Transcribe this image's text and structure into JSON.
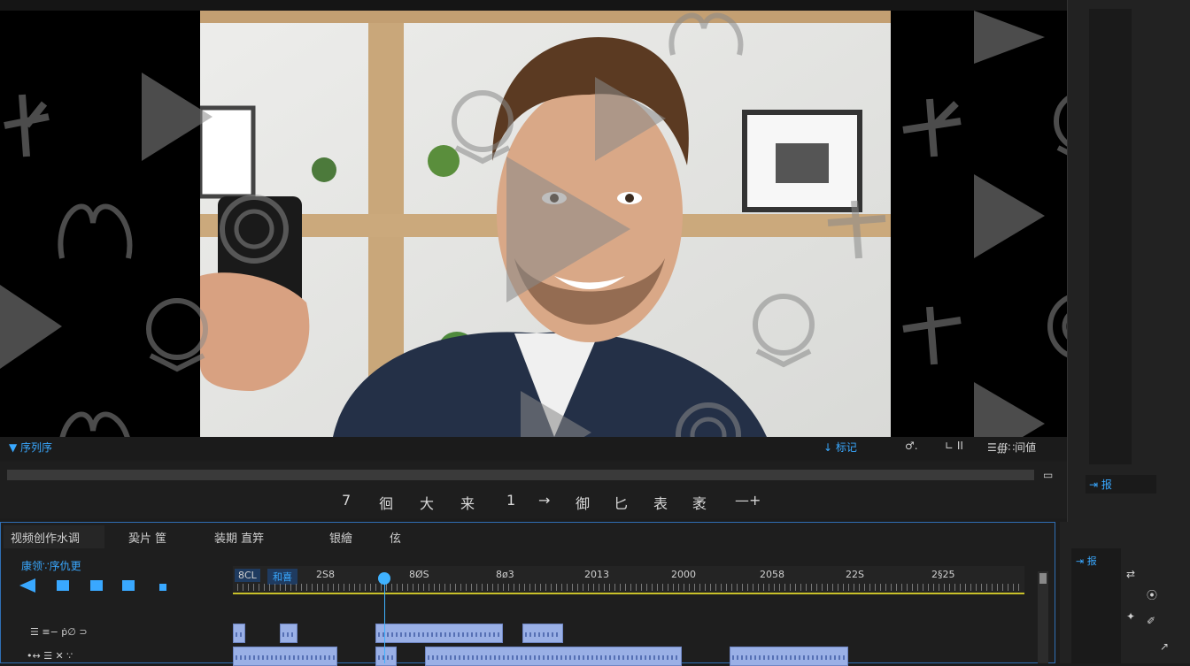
{
  "monitor": {
    "header_label": "▼ 序列序",
    "right_labels": [
      "↓ 标记",
      "♂.",
      "∟ II",
      "☰∰∷间値"
    ],
    "fit_icon": "▭"
  },
  "transport": {
    "buttons": [
      "7",
      "徊",
      "大",
      "来",
      "1",
      "→",
      "御",
      "匕",
      "表",
      "袤",
      "—+"
    ]
  },
  "right_panel": {
    "label": "⇥ 报"
  },
  "timeline": {
    "tabs": [
      "视频创作水调",
      "巬片 筺",
      "装期 直筓",
      "银繪",
      "伭"
    ],
    "track_header": "康领∵序仇更",
    "time_labels": [
      "8CL",
      "和喜",
      "2S8",
      "8ØS",
      "8ø3",
      "2013",
      "2000",
      "2058",
      "22S",
      "2§25"
    ],
    "track_rows": [
      "☰ ≡− ṗ∅ ⊃",
      "•↔ ☰ ✕ ∵"
    ],
    "tool_icons": [
      "⇄",
      "⦿",
      "✦",
      "✐",
      "↗"
    ]
  },
  "colors": {
    "accent": "#39a8ff",
    "clip": "#9ab0e6",
    "ruler_line": "#c9c12a",
    "timeline_border": "#2f6fb5"
  }
}
